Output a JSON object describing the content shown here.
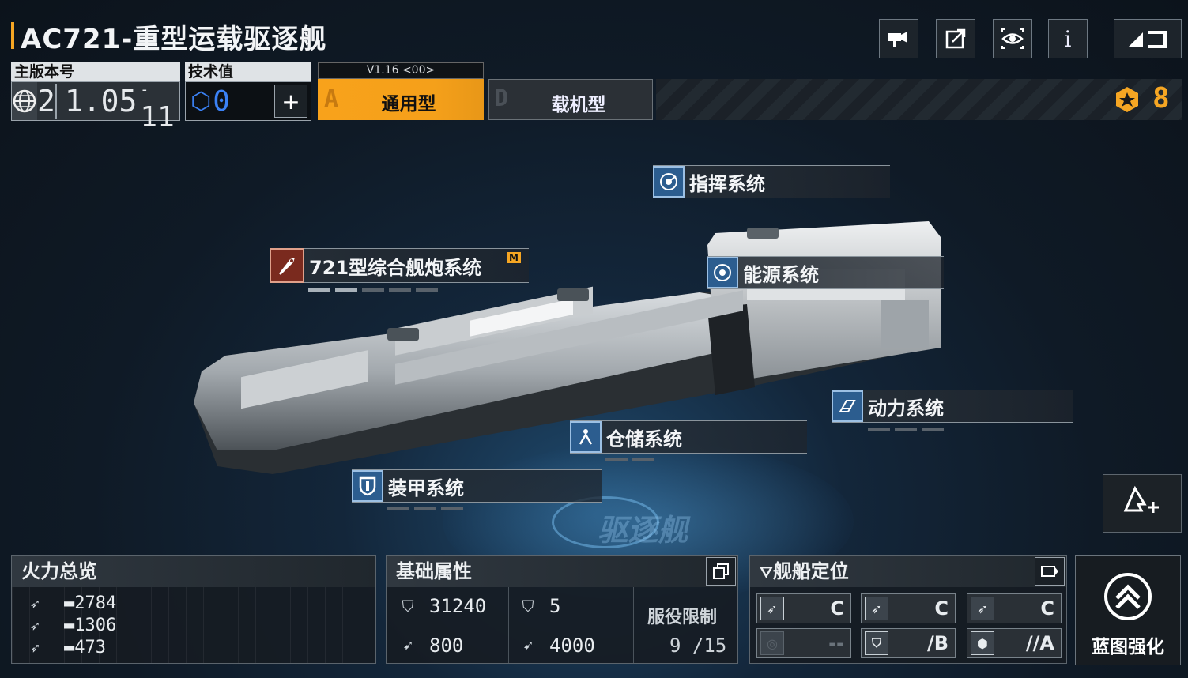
{
  "header": {
    "title": "AC721-重型运载驱逐舰",
    "tools": [
      {
        "name": "camera-icon",
        "glyph": "📹"
      },
      {
        "name": "share-icon",
        "glyph": "⇗"
      },
      {
        "name": "view-icon",
        "glyph": "👁"
      },
      {
        "name": "info-icon",
        "glyph": "i"
      }
    ],
    "back_glyph": "◢⊐"
  },
  "version": {
    "label": "主版本号",
    "index": "2",
    "value": "1.05",
    "sub": "11"
  },
  "tech": {
    "label": "技术值",
    "value": "0",
    "add": "+"
  },
  "types": {
    "version_tag": "V1.16 <00>",
    "a_letter": "A",
    "a_label": "通用型",
    "d_letter": "D",
    "d_label": "载机型"
  },
  "rank": {
    "value": "8"
  },
  "systems": {
    "command": "指挥系统",
    "cannon": "721型综合舰炮系统",
    "cannon_badge": "M",
    "energy": "能源系统",
    "power": "动力系统",
    "storage": "仓储系统",
    "armor": "装甲系统"
  },
  "firepower": {
    "title": "火力总览",
    "rows": [
      "2784",
      "1306",
      "473"
    ]
  },
  "attributes": {
    "title": "基础属性",
    "hp": "31240",
    "armor": "5",
    "speed": "800",
    "range": "4000",
    "service_label": "服役限制",
    "service_value": "9 /15"
  },
  "position": {
    "title": "舰船定位",
    "grades": [
      "C",
      "C",
      "C",
      "--",
      "/B",
      "//A"
    ]
  },
  "enhance": {
    "label": "蓝图强化"
  },
  "watermark": "驱逐舰"
}
